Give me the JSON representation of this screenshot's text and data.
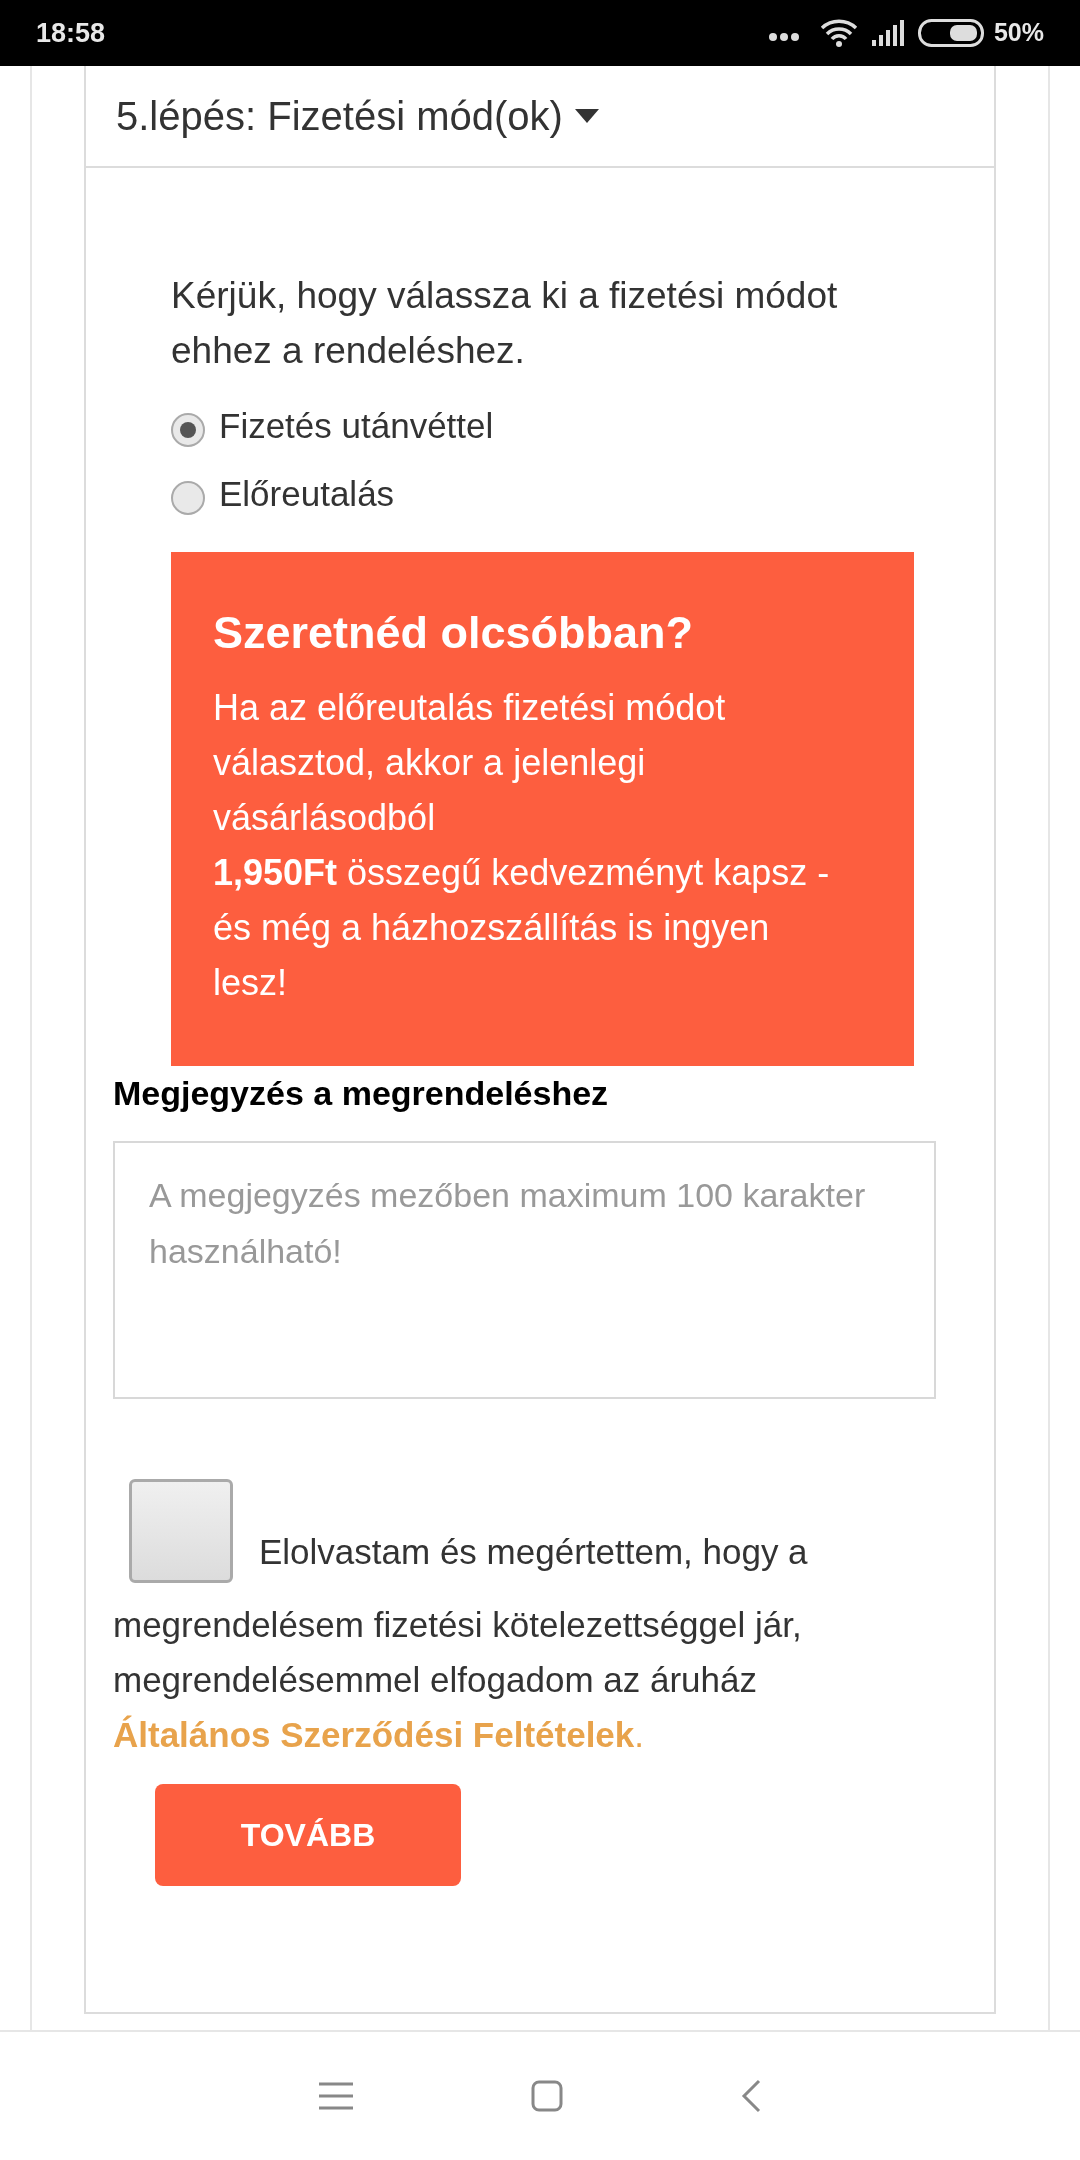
{
  "status_bar": {
    "time": "18:58",
    "battery": "50%"
  },
  "step_header": {
    "title": "5.lépés: Fizetési mód(ok)",
    "expanded": true
  },
  "intro": "Kérjük, hogy válassza ki a fizetési módot ehhez a rendeléshez.",
  "payment_options": [
    {
      "label": "Fizetés utánvéttel",
      "selected": true
    },
    {
      "label": "Előreutalás",
      "selected": false
    }
  ],
  "promo": {
    "title": "Szeretnéd olcsóbban?",
    "body_lines": [
      "Ha az előreutalás fizetési módot választod, akkor a jelenlegi vásárlásodból",
      "**1,950Ft** összegű kedvezményt kapsz - és még a házhozszállítás is ingyen lesz!"
    ]
  },
  "note": {
    "label": "Megjegyzés a megrendeléshez",
    "placeholder": "A megjegyzés mezőben maximum 100 karakter használható!"
  },
  "terms": {
    "checked": false,
    "label": "Elolvastam és megértettem, hogy a",
    "text": "megrendelésem fizetési kötelezettséggel jár, megrendelésemmel elfogadom az áruház",
    "link": "Általános Szerződési Feltételek",
    "suffix": "."
  },
  "continue_button": "TOVÁBB"
}
